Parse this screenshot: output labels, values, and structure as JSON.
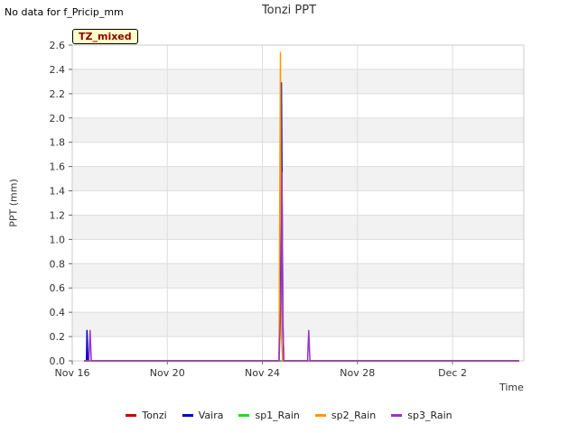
{
  "header": {
    "no_data_text": "No data for f_Pricip_mm",
    "badge": "TZ_mixed"
  },
  "chart_data": {
    "type": "line",
    "title": "Tonzi PPT",
    "xlabel": "Time",
    "ylabel": "PPT (mm)",
    "x_unit": "day of November (Dec 1 = 31)",
    "xlim": [
      16,
      35
    ],
    "ylim": [
      0,
      2.6
    ],
    "grid": true,
    "legend_position": "bottom",
    "yticks": [
      "0.0",
      "0.2",
      "0.4",
      "0.6",
      "0.8",
      "1.0",
      "1.2",
      "1.4",
      "1.6",
      "1.8",
      "2.0",
      "2.2",
      "2.4",
      "2.6"
    ],
    "xticks": [
      {
        "value": 16,
        "label": "Nov 16"
      },
      {
        "value": 20,
        "label": "Nov 20"
      },
      {
        "value": 24,
        "label": "Nov 24"
      },
      {
        "value": 28,
        "label": "Nov 28"
      },
      {
        "value": 32,
        "label": "Dec 2"
      }
    ],
    "series": [
      {
        "name": "Tonzi",
        "color": "#cc0000",
        "points": [
          [
            16.5,
            0
          ],
          [
            34.8,
            0
          ]
        ]
      },
      {
        "name": "Vaira",
        "color": "#0000cc",
        "points": [
          [
            16.5,
            0
          ],
          [
            16.6,
            0
          ],
          [
            16.62,
            0.25
          ],
          [
            16.66,
            0
          ],
          [
            24.7,
            0
          ],
          [
            24.8,
            2.29
          ],
          [
            24.86,
            0.3
          ],
          [
            24.9,
            0
          ],
          [
            34.8,
            0
          ]
        ]
      },
      {
        "name": "sp1_Rain",
        "color": "#22dd22",
        "points": [
          [
            16.5,
            0
          ],
          [
            34.8,
            0
          ]
        ]
      },
      {
        "name": "sp2_Rain",
        "color": "#ff9900",
        "points": [
          [
            16.5,
            0
          ],
          [
            24.7,
            0
          ],
          [
            24.76,
            2.54
          ],
          [
            24.8,
            0.2
          ],
          [
            24.85,
            0
          ],
          [
            34.8,
            0
          ]
        ]
      },
      {
        "name": "sp3_Rain",
        "color": "#9933cc",
        "points": [
          [
            16.5,
            0
          ],
          [
            16.7,
            0
          ],
          [
            16.75,
            0.25
          ],
          [
            16.8,
            0
          ],
          [
            24.7,
            0
          ],
          [
            24.78,
            0.5
          ],
          [
            24.82,
            1.55
          ],
          [
            24.87,
            0.3
          ],
          [
            24.9,
            0
          ],
          [
            25.9,
            0
          ],
          [
            25.95,
            0.25
          ],
          [
            26.0,
            0
          ],
          [
            34.8,
            0
          ]
        ]
      }
    ]
  }
}
